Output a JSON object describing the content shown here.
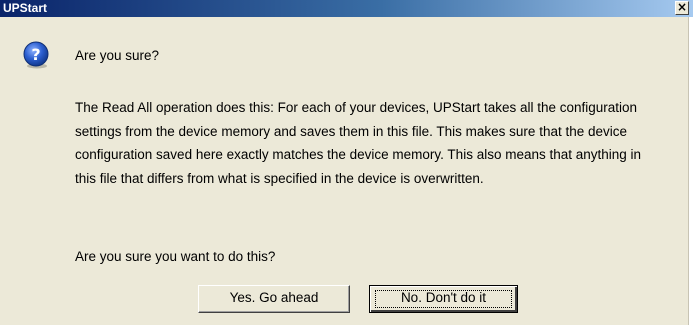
{
  "window": {
    "title": "UPStart",
    "close_label": "×"
  },
  "dialog": {
    "icon": "question-icon",
    "heading": "Are you sure?",
    "body": "The Read All operation does this: For each of your devices, UPStart takes all the configuration settings from the device memory and saves them in this file. This makes sure that the device configuration saved here exactly matches the device memory. This also means that anything in this file that differs from what is specified in the device is overwritten.",
    "confirm": "Are you sure you want to do this?",
    "buttons": {
      "yes_label": "Yes. Go ahead",
      "no_label": "No. Don't do it"
    }
  },
  "colors": {
    "dialog_background": "#ece9d8",
    "titlebar_start": "#0a246a",
    "titlebar_end": "#a6caf0",
    "icon_blue": "#1f4fb0"
  }
}
